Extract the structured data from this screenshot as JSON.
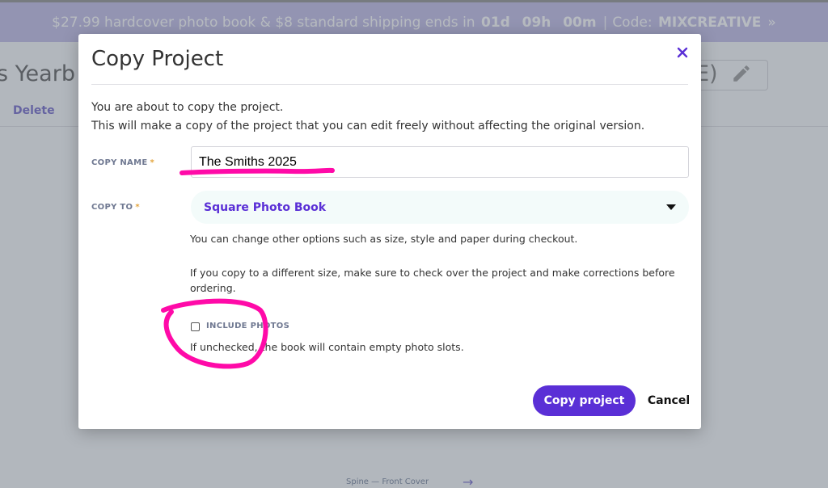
{
  "banner": {
    "prefix": "$27.99 hardcover photo book & $8 standard shipping ends in",
    "days": "01d",
    "hours": "09h",
    "minutes": "00m",
    "code_label": "Code:",
    "code": "MIXCREATIVE",
    "chevron": "»"
  },
  "background": {
    "title_left": "s Yearb",
    "title_right": "E)",
    "delete_label": "Delete",
    "spine_text": "Spine — Front Cover",
    "arrow": "→"
  },
  "modal": {
    "title": "Copy Project",
    "close_glyph": "✕",
    "intro_line1": "You are about to copy the project.",
    "intro_line2": "This will make a copy of the project that you can edit freely without affecting the original version.",
    "copy_name_label": "COPY NAME",
    "required_mark": "*",
    "copy_name_value": "The Smiths 2025",
    "copy_to_label": "COPY TO",
    "copy_to_value": "Square Photo Book",
    "help_options": "You can change other options such as size, style and paper during checkout.",
    "help_size": "If you copy to a different size, make sure to check over the project and make corrections before ordering.",
    "include_photos_label": "INCLUDE PHOTOS",
    "include_photos_checked": false,
    "include_photos_help": "If unchecked, the book will contain empty photo slots.",
    "copy_button": "Copy project",
    "cancel_button": "Cancel"
  },
  "colors": {
    "accent": "#5a2fd6",
    "annotation": "#ff0aa8",
    "banner": "#b7b1e3",
    "required": "#e3a53e"
  }
}
